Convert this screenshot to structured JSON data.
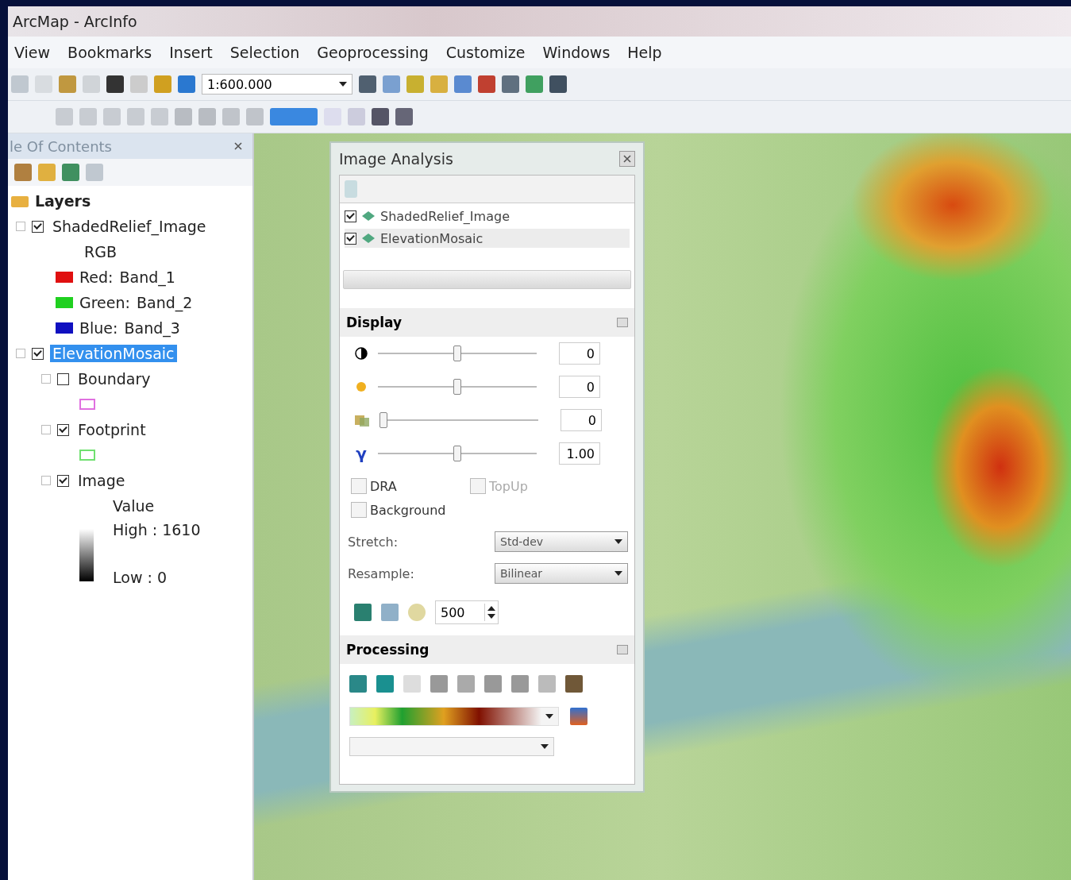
{
  "window": {
    "title": "ArcMap - ArcInfo"
  },
  "menu": [
    "View",
    "Bookmarks",
    "Insert",
    "Selection",
    "Geoprocessing",
    "Customize",
    "Windows",
    "Help"
  ],
  "toolbar": {
    "scale": "1:600.000"
  },
  "toc": {
    "title": "le Of Contents",
    "root": "Layers",
    "layers": [
      {
        "name": "ShadedRelief_Image",
        "checked": true,
        "selected": false,
        "expanded": true,
        "legend_title": "RGB",
        "bands": [
          {
            "color": "#e01010",
            "channel": "Red:",
            "band": "Band_1"
          },
          {
            "color": "#20d020",
            "channel": "Green:",
            "band": "Band_2"
          },
          {
            "color": "#1010c0",
            "channel": "Blue:",
            "band": "Band_3"
          }
        ]
      },
      {
        "name": "ElevationMosaic",
        "checked": true,
        "selected": true,
        "expanded": true,
        "children": [
          {
            "name": "Boundary",
            "checked": false,
            "kind": "outline",
            "color": "#e070e0"
          },
          {
            "name": "Footprint",
            "checked": true,
            "kind": "outline",
            "color": "#70e070"
          },
          {
            "name": "Image",
            "checked": true,
            "kind": "ramp",
            "legend_title": "Value",
            "high": "High : 1610",
            "low": "Low : 0"
          }
        ]
      }
    ]
  },
  "analysis": {
    "title": "Image Analysis",
    "layers": [
      {
        "name": "ShadedRelief_Image",
        "checked": true,
        "selected": false
      },
      {
        "name": "ElevationMosaic",
        "checked": true,
        "selected": true
      }
    ],
    "display": {
      "title": "Display",
      "sliders": [
        {
          "kind": "contrast",
          "level": 0.5,
          "value": "0"
        },
        {
          "kind": "brightness",
          "level": 0.5,
          "value": "0"
        },
        {
          "kind": "transparency",
          "level": 0.0,
          "value": "0"
        },
        {
          "kind": "gamma",
          "level": 0.5,
          "value": "1.00",
          "symbol": "γ"
        }
      ],
      "options": [
        {
          "label": "DRA",
          "checked": false,
          "disabled": false
        },
        {
          "label": "TopUp",
          "checked": false,
          "disabled": true
        },
        {
          "label": "Background",
          "checked": false,
          "disabled": false
        }
      ],
      "dropdowns": [
        {
          "label": "Stretch:",
          "value": "Std-dev"
        },
        {
          "label": "Resample:",
          "value": "Bilinear"
        }
      ],
      "spin_value": "500"
    },
    "processing": {
      "title": "Processing"
    }
  }
}
